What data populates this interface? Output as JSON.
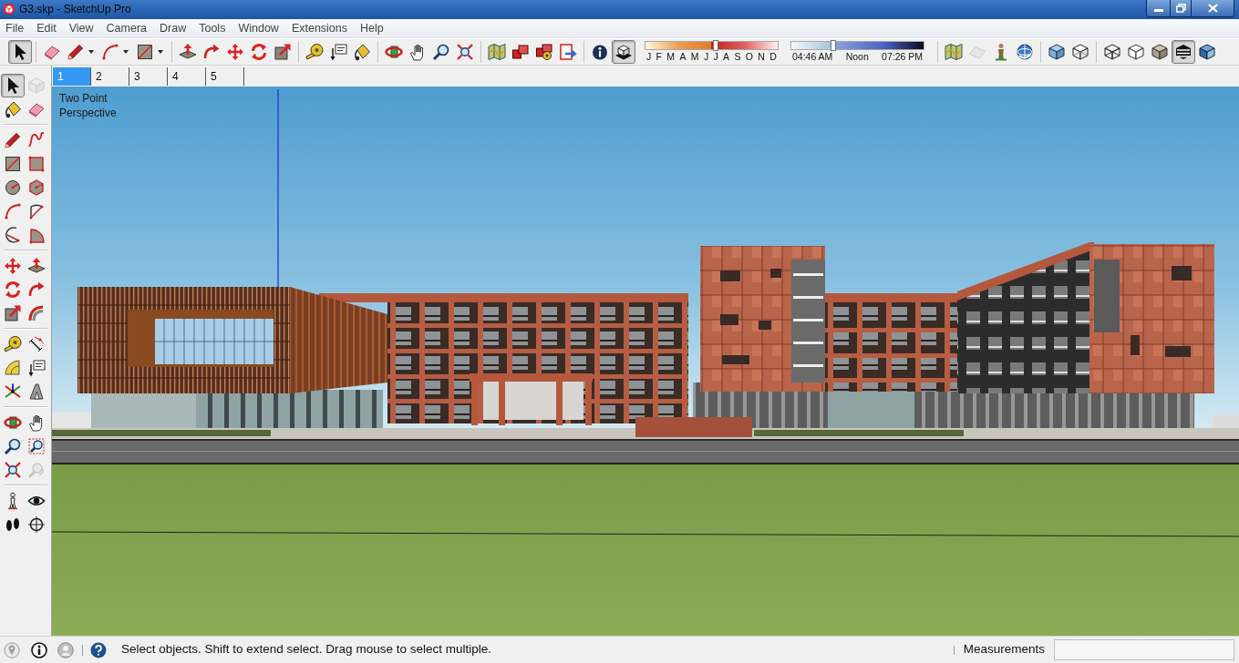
{
  "window": {
    "title": "G3.skp - SketchUp Pro"
  },
  "menu": [
    "File",
    "Edit",
    "View",
    "Camera",
    "Draw",
    "Tools",
    "Window",
    "Extensions",
    "Help"
  ],
  "toolbar": {
    "groups": [
      {
        "kind": "tools",
        "tools": [
          {
            "selected": true,
            "disabled": false
          }
        ]
      },
      {
        "kind": "tools",
        "tools": [
          {
            "selected": false,
            "disabled": false
          },
          {
            "selected": false,
            "disabled": false
          },
          {
            "selected": false,
            "disabled": false
          },
          {
            "selected": false,
            "disabled": false
          }
        ]
      },
      {
        "kind": "tools",
        "tools": [
          {
            "selected": false,
            "disabled": false
          },
          {
            "selected": false,
            "disabled": false
          },
          {
            "selected": false,
            "disabled": false
          },
          {
            "selected": false,
            "disabled": false
          },
          {
            "selected": false,
            "disabled": false
          }
        ]
      },
      {
        "kind": "tools",
        "tools": [
          {
            "selected": false,
            "disabled": false
          },
          {
            "selected": false,
            "disabled": false
          },
          {
            "selected": false,
            "disabled": false
          }
        ]
      },
      {
        "kind": "tools",
        "tools": [
          {
            "selected": false,
            "disabled": false
          },
          {
            "selected": false,
            "disabled": false
          },
          {
            "selected": false,
            "disabled": false
          },
          {
            "selected": false,
            "disabled": false
          }
        ]
      },
      {
        "kind": "tools",
        "tools": [
          {
            "selected": false,
            "disabled": false
          },
          {
            "selected": false,
            "disabled": false
          },
          {
            "selected": false,
            "disabled": false
          },
          {
            "selected": false,
            "disabled": false
          }
        ]
      },
      {
        "kind": "shadows",
        "tools": [
          {
            "selected": false,
            "disabled": false
          },
          {
            "selected": true,
            "disabled": false
          }
        ],
        "month_slider": {
          "labels": [
            "J",
            "F",
            "M",
            "A",
            "M",
            "J",
            "J",
            "A",
            "S",
            "O",
            "N",
            "D"
          ],
          "level": 0.53
        },
        "time_slider": {
          "labels": [
            "04:46 AM",
            "Noon",
            "07:26 PM"
          ],
          "level": 0.32
        }
      },
      {
        "kind": "tools",
        "tools": [
          {
            "selected": false,
            "disabled": false
          },
          {
            "selected": false,
            "disabled": true
          },
          {
            "selected": false,
            "disabled": false
          },
          {
            "selected": false,
            "disabled": false
          }
        ]
      },
      {
        "kind": "tools",
        "tools": [
          {
            "selected": false,
            "disabled": false
          },
          {
            "selected": false,
            "disabled": false
          }
        ]
      },
      {
        "kind": "tools",
        "tools": [
          {
            "selected": false,
            "disabled": false
          },
          {
            "selected": false,
            "disabled": false
          },
          {
            "selected": false,
            "disabled": false
          },
          {
            "selected": true,
            "disabled": false
          },
          {
            "selected": false,
            "disabled": false
          }
        ]
      }
    ]
  },
  "scene_tabs": [
    {
      "label": "1",
      "selected": true
    },
    {
      "label": "2",
      "selected": false
    },
    {
      "label": "3",
      "selected": false
    },
    {
      "label": "4",
      "selected": false
    },
    {
      "label": "5",
      "selected": false
    }
  ],
  "side_toolbar": {
    "groups": [
      {
        "tools": [
          {
            "selected": true,
            "disabled": false
          },
          {
            "selected": false,
            "disabled": true
          },
          {
            "selected": false,
            "disabled": false
          },
          {
            "selected": false,
            "disabled": false
          }
        ]
      },
      {
        "tools": [
          {
            "selected": false,
            "disabled": false
          },
          {
            "selected": false,
            "disabled": false
          },
          {
            "selected": false,
            "disabled": false
          },
          {
            "selected": false,
            "disabled": false
          },
          {
            "selected": false,
            "disabled": false
          },
          {
            "selected": false,
            "disabled": false
          },
          {
            "selected": false,
            "disabled": false
          },
          {
            "selected": false,
            "disabled": false
          },
          {
            "selected": false,
            "disabled": false
          },
          {
            "selected": false,
            "disabled": false
          }
        ]
      },
      {
        "tools": [
          {
            "selected": false,
            "disabled": false
          },
          {
            "selected": false,
            "disabled": false
          },
          {
            "selected": false,
            "disabled": false
          },
          {
            "selected": false,
            "disabled": false
          },
          {
            "selected": false,
            "disabled": false
          },
          {
            "selected": false,
            "disabled": false
          }
        ]
      },
      {
        "tools": [
          {
            "selected": false,
            "disabled": false
          },
          {
            "selected": false,
            "disabled": false
          },
          {
            "selected": false,
            "disabled": false
          },
          {
            "selected": false,
            "disabled": false
          },
          {
            "selected": false,
            "disabled": false
          },
          {
            "selected": false,
            "disabled": false
          }
        ]
      },
      {
        "tools": [
          {
            "selected": false,
            "disabled": false
          },
          {
            "selected": false,
            "disabled": false
          },
          {
            "selected": false,
            "disabled": false
          },
          {
            "selected": false,
            "disabled": false
          },
          {
            "selected": false,
            "disabled": false
          },
          {
            "selected": false,
            "disabled": true
          }
        ]
      },
      {
        "tools": [
          {
            "selected": false,
            "disabled": false
          },
          {
            "selected": false,
            "disabled": false
          },
          {
            "selected": false,
            "disabled": false
          },
          {
            "selected": false,
            "disabled": false
          }
        ]
      }
    ]
  },
  "viewport": {
    "camera_label": "Two Point Perspective"
  },
  "status_bar": {
    "message": "Select objects. Shift to extend select. Drag mouse to select multiple.",
    "measurements_label": "Measurements"
  }
}
